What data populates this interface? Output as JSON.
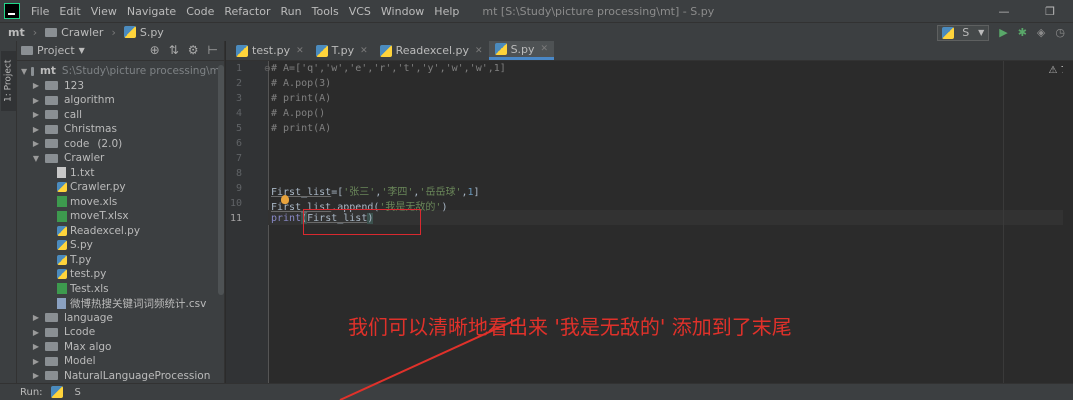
{
  "window": {
    "title": "mt [S:\\Study\\picture processing\\mt] - S.py",
    "menu": [
      "File",
      "Edit",
      "View",
      "Navigate",
      "Code",
      "Refactor",
      "Run",
      "Tools",
      "VCS",
      "Window",
      "Help"
    ]
  },
  "navbar": {
    "project": "mt",
    "folder": "Crawler",
    "file": "S.py",
    "run_config": "S"
  },
  "left_strip": {
    "label": "1: Project"
  },
  "project_panel": {
    "title": "Project",
    "root": {
      "name": "mt",
      "path": "S:\\Study\\picture processing\\mt"
    },
    "items": [
      {
        "name": "123",
        "type": "folder",
        "depth": 1,
        "expanded": false
      },
      {
        "name": "algorithm",
        "type": "folder",
        "depth": 1,
        "expanded": false
      },
      {
        "name": "call",
        "type": "folder",
        "depth": 1,
        "expanded": false
      },
      {
        "name": "Christmas",
        "type": "folder",
        "depth": 1,
        "expanded": false
      },
      {
        "name": "code",
        "count": "(2.0)",
        "type": "folder",
        "depth": 1,
        "expanded": false
      },
      {
        "name": "Crawler",
        "type": "folder",
        "depth": 1,
        "expanded": true
      },
      {
        "name": "1.txt",
        "type": "txt",
        "depth": 2
      },
      {
        "name": "Crawler.py",
        "type": "py",
        "depth": 2
      },
      {
        "name": "move.xls",
        "type": "xls",
        "depth": 2
      },
      {
        "name": "moveT.xlsx",
        "type": "xls",
        "depth": 2
      },
      {
        "name": "Readexcel.py",
        "type": "py",
        "depth": 2
      },
      {
        "name": "S.py",
        "type": "py",
        "depth": 2
      },
      {
        "name": "T.py",
        "type": "py",
        "depth": 2
      },
      {
        "name": "test.py",
        "type": "py",
        "depth": 2
      },
      {
        "name": "Test.xls",
        "type": "xls",
        "depth": 2
      },
      {
        "name": "微博热搜关键词词频统计.csv",
        "type": "csv",
        "depth": 2
      },
      {
        "name": "language",
        "type": "folder",
        "depth": 1,
        "expanded": false
      },
      {
        "name": "Lcode",
        "type": "folder",
        "depth": 1,
        "expanded": false
      },
      {
        "name": "Max algo",
        "type": "folder",
        "depth": 1,
        "expanded": false
      },
      {
        "name": "Model",
        "type": "folder",
        "depth": 1,
        "expanded": false
      },
      {
        "name": "NaturalLanguageProcession",
        "type": "folder",
        "depth": 1,
        "expanded": false
      }
    ]
  },
  "tabs": [
    {
      "label": "test.py",
      "active": false
    },
    {
      "label": "T.py",
      "active": false
    },
    {
      "label": "Readexcel.py",
      "active": false
    },
    {
      "label": "S.py",
      "active": true
    }
  ],
  "editor": {
    "line_numbers": [
      "1",
      "2",
      "3",
      "4",
      "5",
      "6",
      "7",
      "8",
      "9",
      "10",
      "11"
    ],
    "lines": [
      "# A=['q','w','e','r','t','y','w','w',1]",
      "# A.pop(3)",
      "# print(A)",
      "# A.pop()",
      "# print(A)",
      "",
      "",
      "",
      "First_list=['张三','李四','岳岳球',1]",
      "First_list.append('我是无敌的')",
      "print(First_list)"
    ],
    "warning_count": "7",
    "annotation": "我们可以清晰地看出来 '我是无敌的' 添加到了末尾",
    "accent_color": "#e0312a"
  },
  "runbar": {
    "label": "Run:",
    "config": "S"
  }
}
